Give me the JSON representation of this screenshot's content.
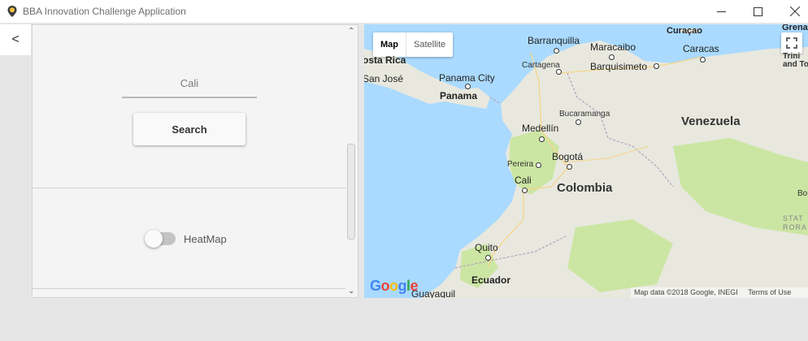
{
  "window": {
    "title": "BBA Innovation Challenge Application",
    "controls": {
      "minimize": "minimize-icon",
      "maximize": "maximize-icon",
      "close": "close-icon"
    }
  },
  "nav": {
    "back_label": "<"
  },
  "search": {
    "value": "Cali",
    "button_label": "Search"
  },
  "heatmap": {
    "label": "HeatMap",
    "enabled": false
  },
  "map": {
    "type_options": [
      "Map",
      "Satellite"
    ],
    "selected_type": "Map",
    "labels": {
      "curacao": "Curaçao",
      "grenada": "Grenac",
      "barranquilla": "Barranquilla",
      "maracaibo": "Maracaibo",
      "caracas": "Caracas",
      "costa_rica": "osta Rica",
      "san_jose": "San José",
      "panama_city": "Panama City",
      "cartagena": "Cartagena",
      "barquisimeto": "Barquisimeto",
      "trinidad": "Trini",
      "trinidad2": "and To",
      "panama": "Panama",
      "bucaramanga": "Bucaramanga",
      "venezuela": "Venezuela",
      "medellin": "Medellín",
      "bogota": "Bogotá",
      "pereira": "Pereira",
      "cali": "Cali",
      "colombia": "Colombia",
      "bo": "Bo",
      "state1": "STAT",
      "state2": "RORA",
      "quito": "Quito",
      "ecuador": "Ecuador",
      "guayaquil": "Guayaquil"
    },
    "logo": "Google",
    "attribution": "Map data ©2018 Google, INEGI",
    "terms": "Terms of Use",
    "colors": {
      "water": "#aadaff",
      "land": "#e8e8df",
      "green": "#cbe6a3"
    }
  }
}
